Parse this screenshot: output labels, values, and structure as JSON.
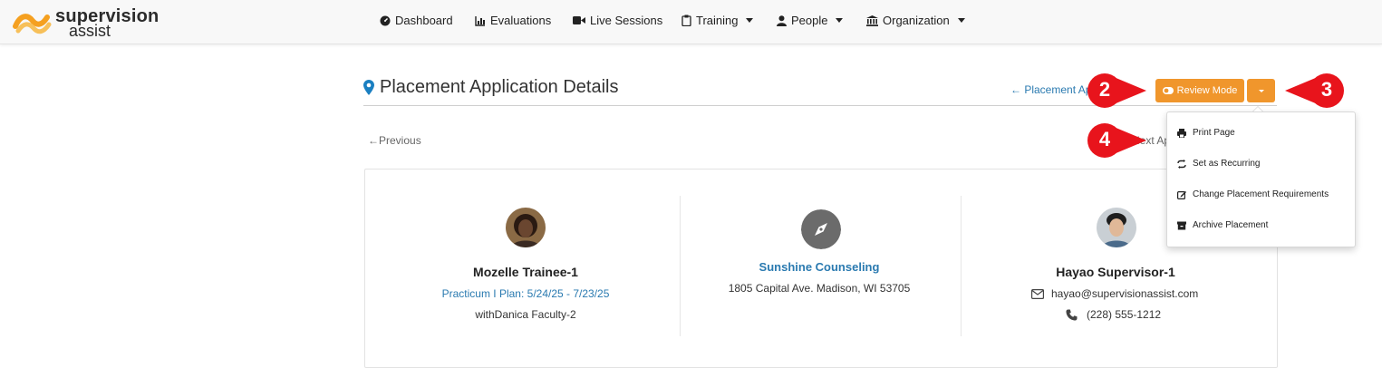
{
  "brand": {
    "line1": "supervision",
    "line2": "assist",
    "colors": {
      "orange": "#f5a020",
      "accent": "#f0962c",
      "link": "#2a7ab0",
      "callout": "#e8141c"
    }
  },
  "nav": [
    {
      "label": "Dashboard",
      "icon": "tachometer-icon",
      "has_caret": false
    },
    {
      "label": "Evaluations",
      "icon": "bar-chart-icon",
      "has_caret": false
    },
    {
      "label": "Live Sessions",
      "icon": "video-camera-icon",
      "has_caret": false
    },
    {
      "label": "Training",
      "icon": "clipboard-icon",
      "has_caret": true
    },
    {
      "label": "People",
      "icon": "user-icon",
      "has_caret": true
    },
    {
      "label": "Organization",
      "icon": "institution-icon",
      "has_caret": true
    }
  ],
  "page": {
    "title": "Placement Application Details",
    "back_link": "← Placement Applications",
    "review_button": "Review Mode",
    "previous": "←Previous",
    "next": "Next Application Co"
  },
  "dropdown": [
    {
      "label": "Print Page",
      "icon": "print-icon"
    },
    {
      "label": "Set as Recurring",
      "icon": "repeat-icon"
    },
    {
      "label": "Change Placement Requirements",
      "icon": "edit-icon"
    },
    {
      "label": "Archive Placement",
      "icon": "archive-icon"
    }
  ],
  "trainee": {
    "name": "Mozelle Trainee-1",
    "plan": "Practicum I Plan: 5/24/25 - 7/23/25",
    "with": "withDanica Faculty-2"
  },
  "site": {
    "name": "Sunshine Counseling",
    "address": "1805 Capital Ave. Madison, WI 53705"
  },
  "supervisor": {
    "name": "Hayao Supervisor-1",
    "email": "hayao@supervisionassist.com",
    "phone": "(228) 555-1212"
  },
  "callouts": {
    "two": "2",
    "three": "3",
    "four": "4"
  }
}
